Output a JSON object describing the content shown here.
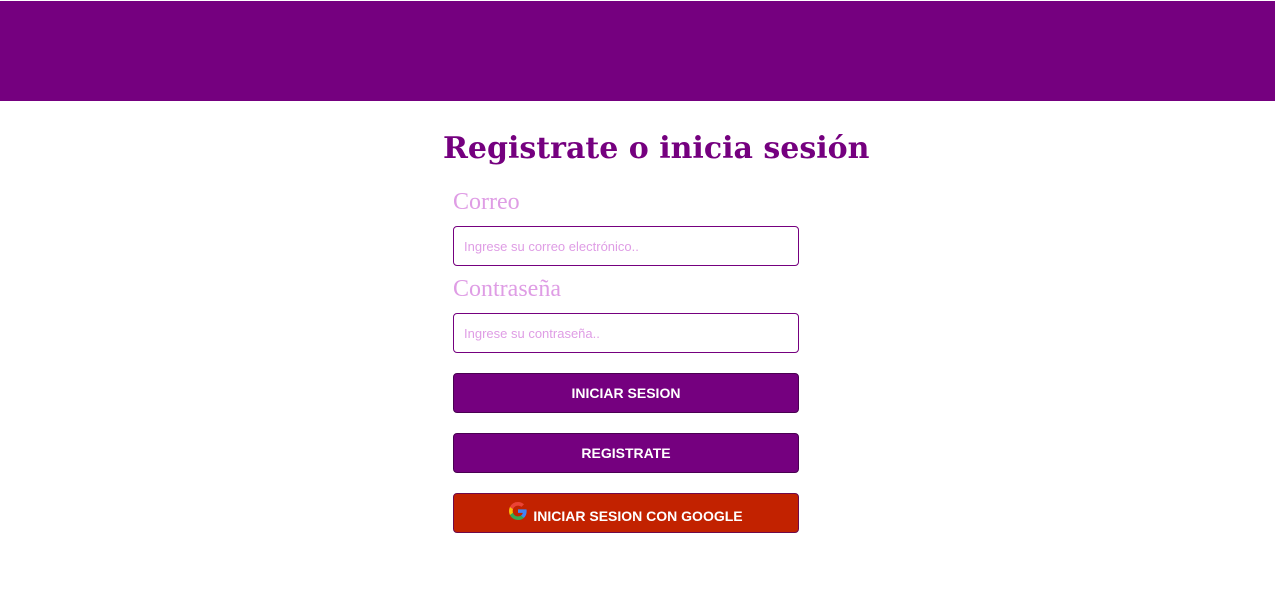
{
  "header": {
    "background_color": "#75007f"
  },
  "page": {
    "title": "Registrate o inicia sesión"
  },
  "form": {
    "email": {
      "label": "Correo",
      "value": "",
      "placeholder": "Ingrese su correo electrónico.."
    },
    "password": {
      "label": "Contraseña",
      "value": "",
      "placeholder": "Ingrese su contraseña.."
    }
  },
  "buttons": {
    "login_label": "INICIAR SESION",
    "register_label": "REGISTRATE",
    "google_label": "INICIAR SESION CON GOOGLE",
    "google_icon": "google-icon"
  },
  "colors": {
    "accent": "#75007f",
    "label": "#df9de5",
    "google_button": "#c22200"
  }
}
